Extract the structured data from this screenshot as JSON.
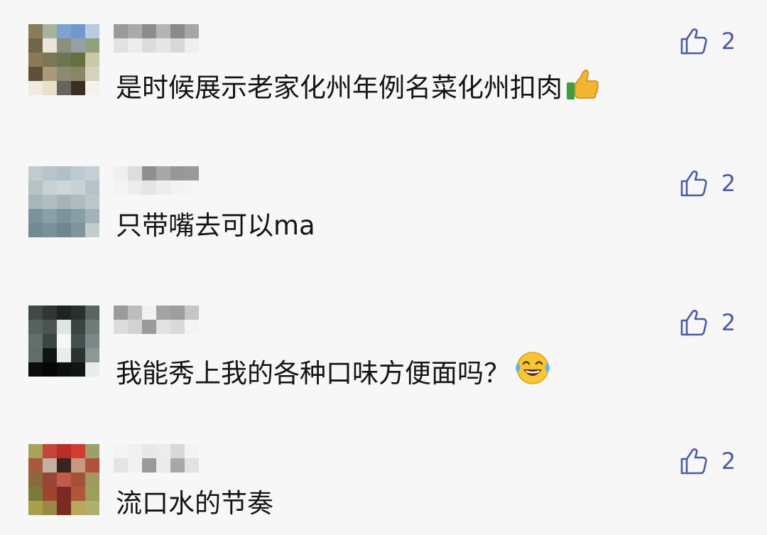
{
  "comments": [
    {
      "text": "是时候展示老家化州年例名菜化州扣肉",
      "emoji": "thumbs-up-icon",
      "likes": "2"
    },
    {
      "text": "只带嘴去可以ma",
      "emoji": "",
      "likes": "2"
    },
    {
      "text": "我能秀上我的各种口味方便面吗？",
      "emoji": "laughing-tears-icon",
      "likes": "2"
    },
    {
      "text": "流口水的节奏",
      "emoji": "",
      "likes": "2"
    }
  ],
  "colors": {
    "like_accent": "#4b5aa6",
    "background": "#f7f7f7"
  }
}
